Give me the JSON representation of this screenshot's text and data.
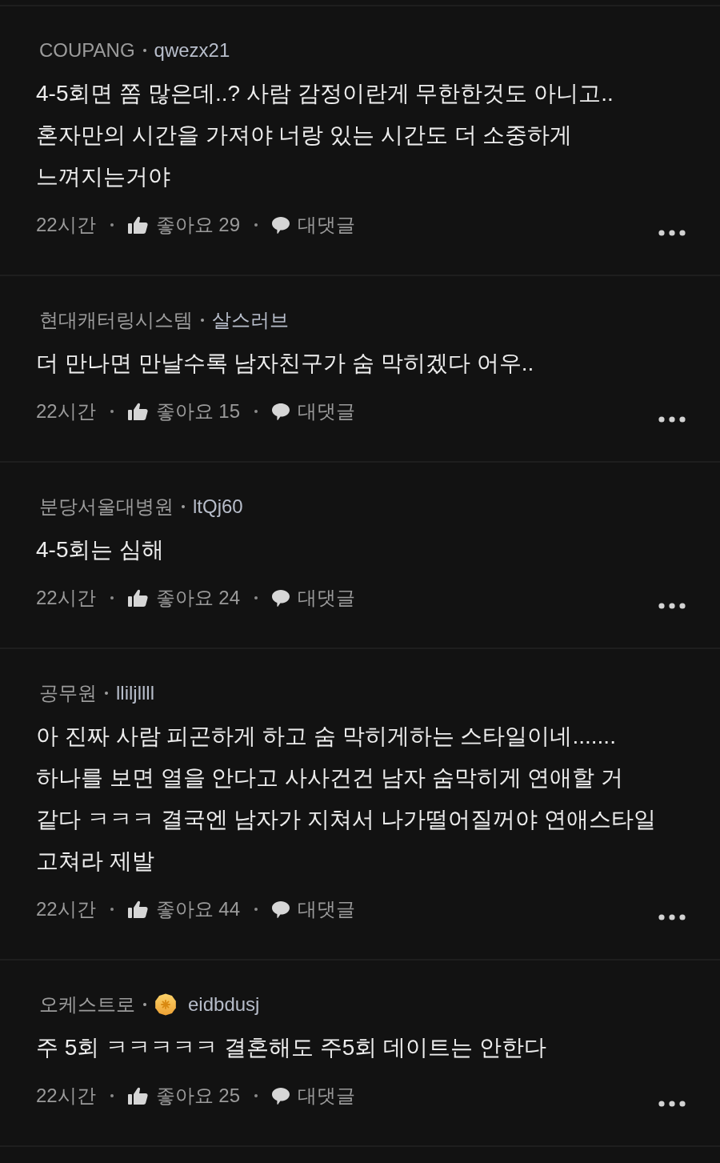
{
  "comments": [
    {
      "company": "COUPANG",
      "username": "qwezx21",
      "badge": false,
      "body": [
        "4-5회면 쫌 많은데..? 사람 감정이란게 무한한것도 아니고..",
        "혼자만의 시간을 가져야 너랑 있는 시간도 더 소중하게",
        "느껴지는거야"
      ],
      "time": "22시간",
      "likes": "좋아요 29",
      "reply": "대댓글"
    },
    {
      "company": "현대캐터링시스템",
      "username": "살스러브",
      "badge": false,
      "body": [
        "더 만나면 만날수록 남자친구가 숨 막히겠다 어우.."
      ],
      "time": "22시간",
      "likes": "좋아요 15",
      "reply": "대댓글"
    },
    {
      "company": "분당서울대병원",
      "username": "ltQj60",
      "badge": false,
      "body": [
        "4-5회는 심해"
      ],
      "time": "22시간",
      "likes": "좋아요 24",
      "reply": "대댓글"
    },
    {
      "company": "공무원",
      "username": "lliljllll",
      "badge": false,
      "body": [
        "아 진짜 사람 피곤하게 하고 숨 막히게하는 스타일이네.......",
        "하나를 보면 열을 안다고 사사건건 남자 숨막히게 연애할 거",
        "같다 ㅋㅋㅋ 결국엔 남자가 지쳐서 나가떨어질꺼야 연애스타일",
        "고쳐라 제발"
      ],
      "time": "22시간",
      "likes": "좋아요 44",
      "reply": "대댓글"
    },
    {
      "company": "오케스트로",
      "username": "eidbdusj",
      "badge": true,
      "body": [
        "주 5회 ㅋㅋㅋㅋㅋ 결혼해도 주5회 데이트는 안한다"
      ],
      "time": "22시간",
      "likes": "좋아요 25",
      "reply": "대댓글"
    }
  ]
}
